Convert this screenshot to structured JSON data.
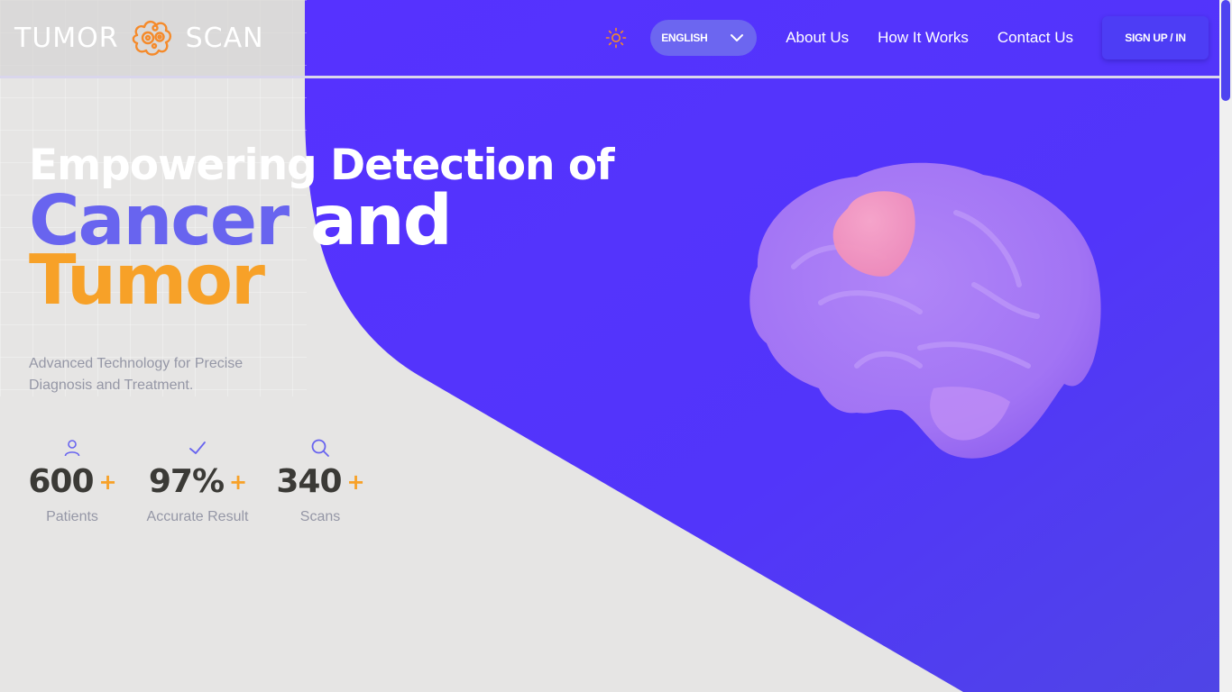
{
  "brand": {
    "name_left": "TUMOR",
    "name_right": "SCAN",
    "icon": "cell-logo-icon",
    "accent_color": "#f58a2a"
  },
  "header": {
    "theme_icon": "sun-icon",
    "language": {
      "selected": "ENGLISH",
      "icon": "chevron-down-icon"
    },
    "nav_links": [
      "About Us",
      "How It Works",
      "Contact Us"
    ],
    "signup_label": "SIGN UP / IN"
  },
  "hero": {
    "line1": "Empowering Detection of",
    "line2_highlight": "Cancer",
    "line2_rest": "and",
    "line3": "Tumor",
    "subtitle": "Advanced Technology for Precise Diagnosis and Treatment."
  },
  "stats": [
    {
      "icon": "user-icon",
      "value": "600",
      "plus": "+",
      "label": "Patients"
    },
    {
      "icon": "check-icon",
      "value": "97%",
      "plus": "+",
      "label": "Accurate Result"
    },
    {
      "icon": "search-icon",
      "value": "340",
      "plus": "+",
      "label": "Scans"
    }
  ],
  "colors": {
    "primary_blue": "#5233fb",
    "highlight_blue": "#6864ef",
    "orange": "#f7a128",
    "background": "#e6e5e4"
  }
}
